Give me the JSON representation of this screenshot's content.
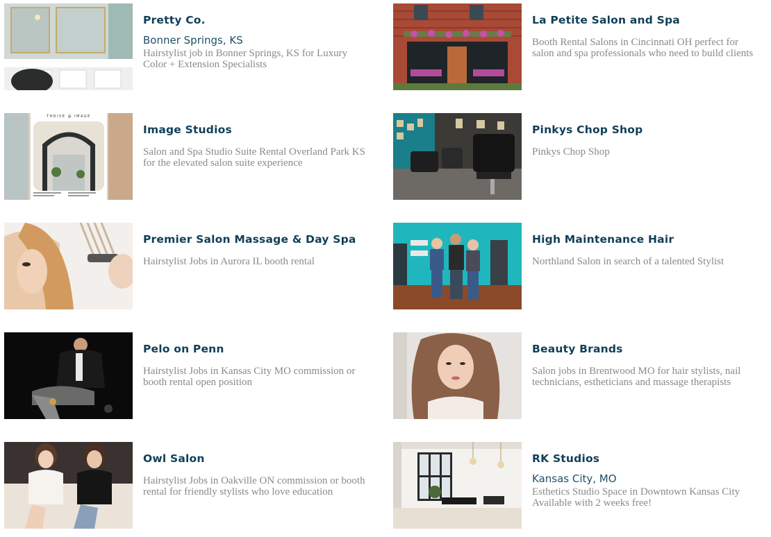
{
  "listings": [
    {
      "title": "Pretty Co.",
      "location": "Bonner Springs, KS",
      "description": "Hairstylist job in Bonner Springs, KS for Luxury Color + Extension Specialists",
      "image_icon": "salon-interior-image"
    },
    {
      "title": "La Petite Salon and Spa",
      "location": "",
      "description": "Booth Rental Salons in Cincinnati OH perfect for salon and spa professionals who need to build clients",
      "image_icon": "salon-storefront-image"
    },
    {
      "title": "Image Studios",
      "location": "",
      "description": "Salon and Spa Studio Suite Rental Overland Park KS for the elevated salon suite experience",
      "image_icon": "studio-suite-flyer-image",
      "image_text": "THRIVE @ IMAGE"
    },
    {
      "title": "Pinkys Chop Shop",
      "location": "",
      "description": "Pinkys Chop Shop",
      "image_icon": "barber-shop-image"
    },
    {
      "title": "Premier Salon Massage & Day Spa",
      "location": "",
      "description": "Hairstylist Jobs in Aurora IL booth rental",
      "image_icon": "hair-styling-image"
    },
    {
      "title": "High Maintenance Hair",
      "location": "",
      "description": "Northland Salon in search of a talented Stylist",
      "image_icon": "salon-team-image"
    },
    {
      "title": "Pelo on Penn",
      "location": "",
      "description": "Hairstylist Jobs in Kansas City MO commission or booth rental open position",
      "image_icon": "stylist-portrait-image"
    },
    {
      "title": "Beauty Brands",
      "location": "",
      "description": "Salon jobs in Brentwood MO for hair stylists, nail technicians, estheticians and massage therapists",
      "image_icon": "model-portrait-image"
    },
    {
      "title": "Owl Salon",
      "location": "",
      "description": "Hairstylist Jobs in Oakville ON commission or booth rental for friendly stylists who love education",
      "image_icon": "two-stylists-image"
    },
    {
      "title": "RK Studios",
      "location": "Kansas City, MO",
      "description": "Esthetics Studio Space in Downtown Kansas City Available with 2 weeks free!",
      "image_icon": "studio-space-image"
    }
  ],
  "colors": {
    "title": "#0f3f57",
    "location": "#1e5068",
    "description": "#8a8a8a"
  }
}
